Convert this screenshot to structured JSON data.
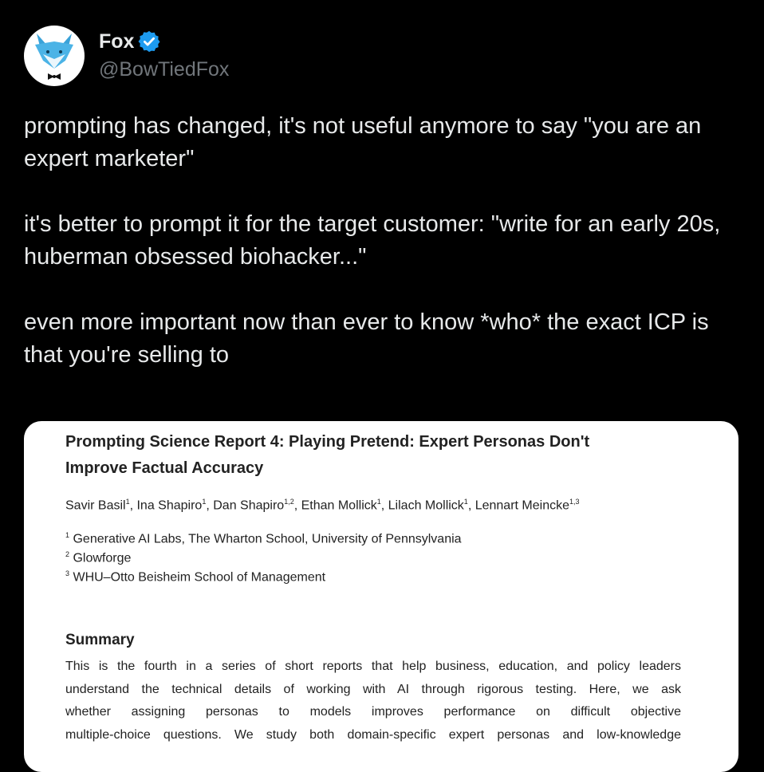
{
  "author": {
    "display_name": "Fox",
    "handle": "@BowTiedFox",
    "verified_color": "#1d9bf0"
  },
  "tweet": {
    "paragraphs": [
      "prompting has changed, it's not useful anymore to say \"you are an expert marketer\"",
      "it's better to prompt it for the target customer: \"write for an early 20s, huberman obsessed biohacker...\"",
      "even more important now than ever to know *who* the exact ICP is that you're selling to"
    ]
  },
  "attachment": {
    "title": "Prompting Science Report 4: Playing Pretend: Expert Personas Don't Improve Factual Accuracy",
    "authors": [
      {
        "name": "Savir Basil",
        "aff": "1"
      },
      {
        "name": "Ina Shapiro",
        "aff": "1"
      },
      {
        "name": "Dan Shapiro",
        "aff": "1,2"
      },
      {
        "name": "Ethan Mollick",
        "aff": "1"
      },
      {
        "name": "Lilach Mollick",
        "aff": "1"
      },
      {
        "name": "Lennart Meincke",
        "aff": "1,3"
      }
    ],
    "affiliations": [
      {
        "num": "1",
        "text": "Generative AI Labs, The Wharton School, University of Pennsylvania"
      },
      {
        "num": "2",
        "text": "Glowforge"
      },
      {
        "num": "3",
        "text": "WHU–Otto Beisheim School of Management"
      }
    ],
    "summary_heading": "Summary",
    "summary_lines": [
      "This is the fourth in a series of short reports that help business, education, and policy leaders",
      "understand the technical details of working with AI through rigorous testing. Here, we ask",
      "whether assigning personas to models improves performance on difficult objective",
      "multiple-choice questions. We study both domain-specific expert personas and low-knowledge"
    ]
  }
}
